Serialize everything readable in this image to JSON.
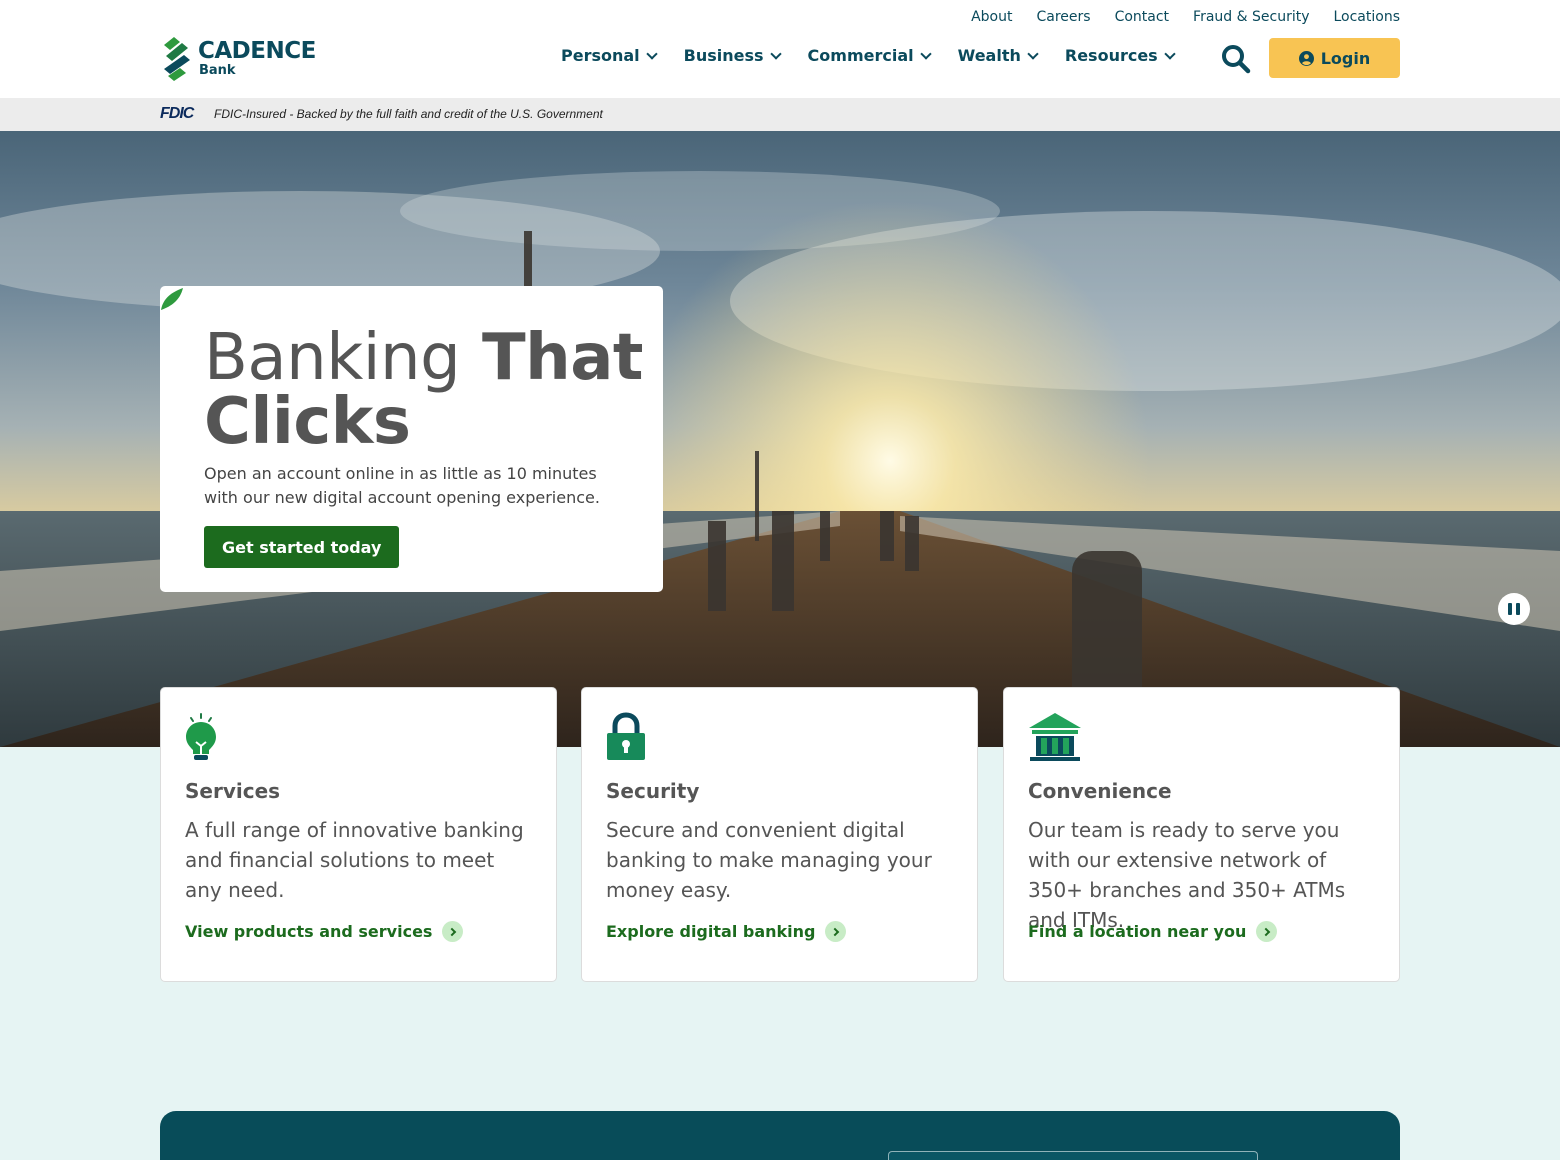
{
  "utility_nav": [
    "About",
    "Careers",
    "Contact",
    "Fraud & Security",
    "Locations"
  ],
  "logo": {
    "name": "CADENCE",
    "sub": "Bank"
  },
  "main_nav": [
    "Personal",
    "Business",
    "Commercial",
    "Wealth",
    "Resources"
  ],
  "header": {
    "login_label": "Login",
    "search_icon": "search-icon",
    "user_icon": "user-circle-icon"
  },
  "fdic": {
    "logo": "FDIC",
    "text": "FDIC-Insured - Backed by the full faith and credit of the U.S. Government"
  },
  "hero": {
    "title_light": "Banking",
    "title_bold_1": "That",
    "title_bold_2": "Clicks",
    "body": "Open an account online in as little as 10 minutes with our new digital account opening experience.",
    "cta": "Get started today",
    "pause_icon": "pause-icon"
  },
  "cards": [
    {
      "icon": "lightbulb-icon",
      "title": "Services",
      "body": "A full range of innovative banking and financial solutions to meet any need.",
      "link": "View products and services"
    },
    {
      "icon": "lock-icon",
      "title": "Security",
      "body": "Secure and convenient digital banking to make managing your money easy.",
      "link": "Explore digital banking"
    },
    {
      "icon": "bank-building-icon",
      "title": "Convenience",
      "body": "Our team is ready to serve you with our extensive network of 350+ branches and 350+ ATMs and ITMs.",
      "link": "Find a location near you"
    }
  ],
  "colors": {
    "brand_teal": "#0b4a5c",
    "brand_green": "#1c6b1e",
    "login_yellow": "#f8c453",
    "section_bg": "#e6f4f3"
  }
}
